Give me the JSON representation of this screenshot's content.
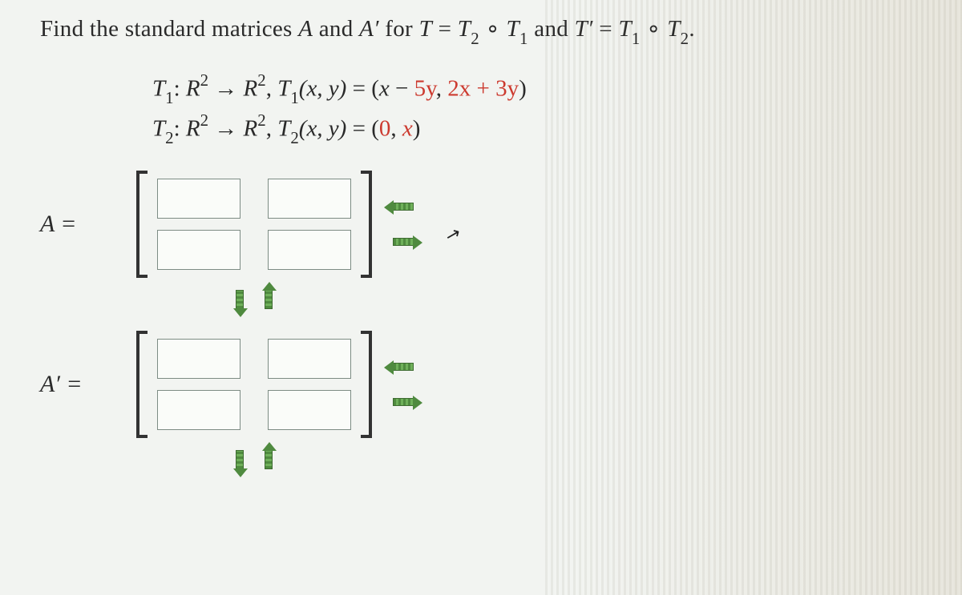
{
  "problem": {
    "prefix": "Find the standard matrices ",
    "A": "A",
    "and1": " and ",
    "Aprime": "A′",
    "for1": " for  ",
    "T": "T",
    "eq1": " = ",
    "T2": "T",
    "sub2a": "2",
    "circ1": " ∘ ",
    "T1": "T",
    "sub1a": "1",
    "and2": " and ",
    "Tp": "T′",
    "eq2": " = ",
    "T1b": "T",
    "sub1b": "1",
    "circ2": " ∘ ",
    "T2b": "T",
    "sub2b": "2",
    "period": "."
  },
  "defs": {
    "line1": {
      "lead": "T",
      "sub": "1",
      "colon": ": ",
      "R1": "R",
      "sup1": "2",
      "arrow": " → ",
      "R2": "R",
      "sup2": "2",
      "comma": ", ",
      "Tfun": "T",
      "Tfunsub": "1",
      "args": "(x, y)",
      "eq": " = ",
      "open": "(",
      "r1": "x",
      "minus": " − ",
      "r2": "5y",
      "c": ", ",
      "r3": "2x",
      "plus": " + ",
      "r4": "3y",
      "close": ")"
    },
    "line2": {
      "lead": "T",
      "sub": "2",
      "colon": ": ",
      "R1": "R",
      "sup1": "2",
      "arrow": " → ",
      "R2": "R",
      "sup2": "2",
      "comma": ", ",
      "Tfun": "T",
      "Tfunsub": "2",
      "args": "(x, y)",
      "eq": " = ",
      "open": "(",
      "r1": "0",
      "c": ", ",
      "r2": "x",
      "close": ")"
    }
  },
  "matrices": {
    "A": {
      "label": "A =",
      "cells": [
        "",
        "",
        "",
        ""
      ]
    },
    "Aprime": {
      "label": "A′ =",
      "cells": [
        "",
        "",
        "",
        ""
      ]
    }
  },
  "arrows": {
    "remove_col": "remove-column",
    "add_col": "add-column",
    "remove_row": "remove-row",
    "add_row": "add-row"
  },
  "cursor_glyph": "↖"
}
